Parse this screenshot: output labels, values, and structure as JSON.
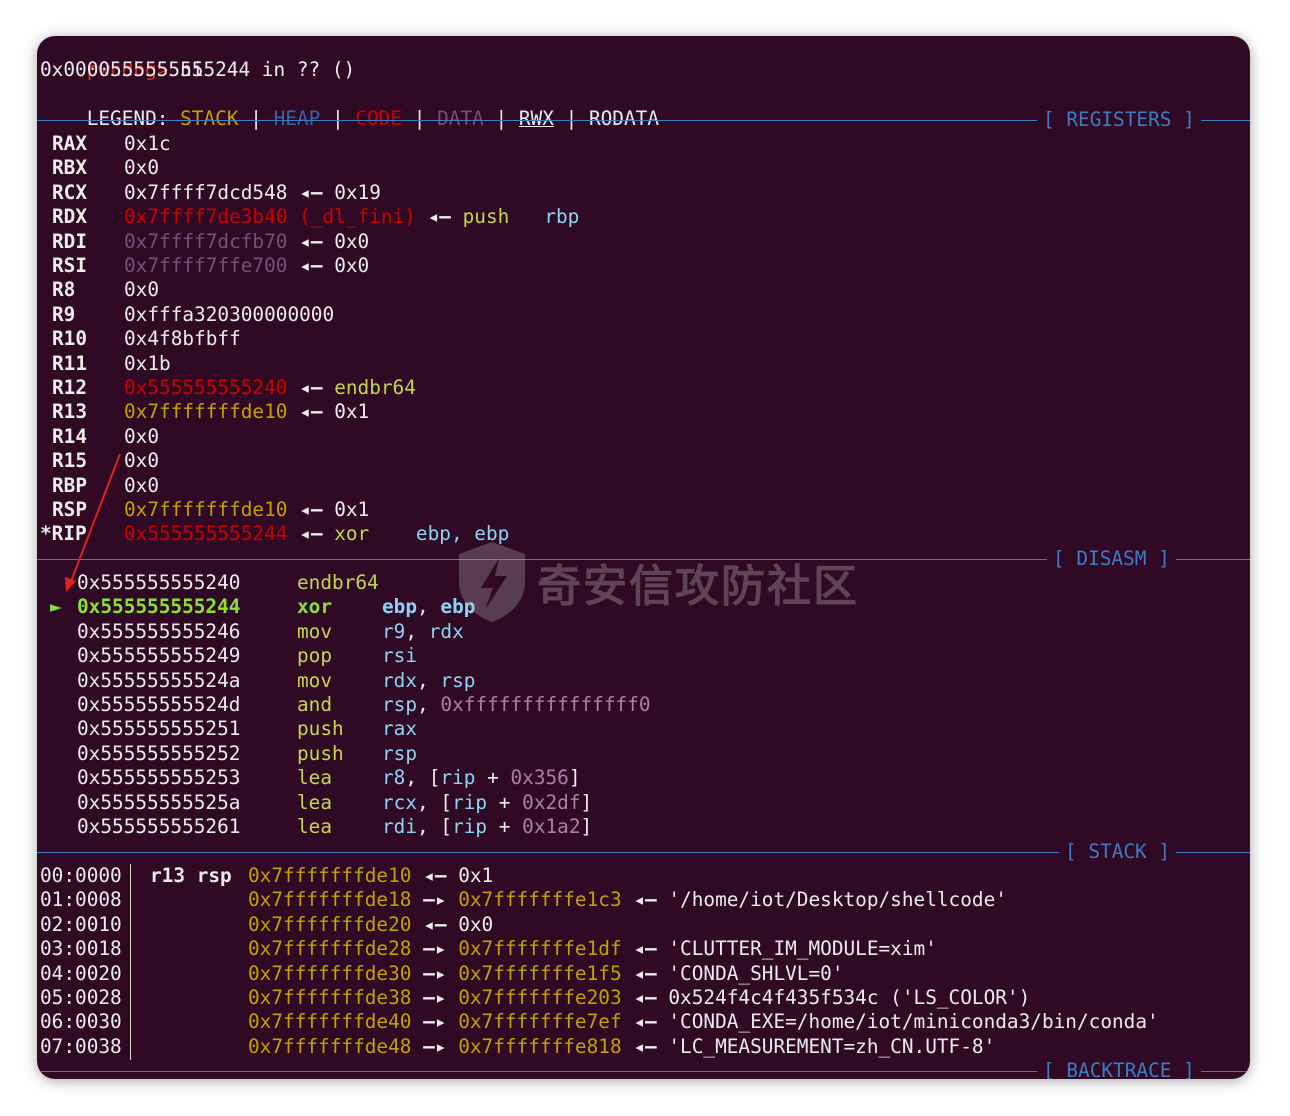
{
  "header": {
    "prompt": "pwndbg>",
    "command": "ni",
    "location": "0x0000555555555244 in ?? ()",
    "legend_label": "LEGEND:",
    "legend": [
      "STACK",
      "HEAP",
      "CODE",
      "DATA",
      "RWX",
      "RODATA"
    ],
    "legend_sep": "|"
  },
  "sections": {
    "registers": "[ REGISTERS ]",
    "disasm": "[ DISASM ]",
    "stack": "[ STACK ]",
    "backtrace": "[ BACKTRACE ]"
  },
  "registers": [
    {
      "name": "RAX",
      "value": "0x1c"
    },
    {
      "name": "RBX",
      "value": "0x0"
    },
    {
      "name": "RCX",
      "value": "0x7ffff7dcd548",
      "arrow": "◂—",
      "target": "0x19"
    },
    {
      "name": "RDX",
      "value": "0x7ffff7de3b40 (_dl_fini)",
      "arrow": "◂—",
      "instr": "push",
      "operands": "rbp"
    },
    {
      "name": "RDI",
      "value": "0x7ffff7dcfb70",
      "arrow": "◂—",
      "target": "0x0"
    },
    {
      "name": "RSI",
      "value": "0x7ffff7ffe700",
      "arrow": "◂—",
      "target": "0x0"
    },
    {
      "name": "R8",
      "value": "0x0"
    },
    {
      "name": "R9",
      "value": "0xfffa320300000000"
    },
    {
      "name": "R10",
      "value": "0x4f8bfbff"
    },
    {
      "name": "R11",
      "value": "0x1b"
    },
    {
      "name": "R12",
      "value": "0x555555555240",
      "arrow": "◂—",
      "instr": "endbr64"
    },
    {
      "name": "R13",
      "value": "0x7fffffffde10",
      "arrow": "◂—",
      "target": "0x1"
    },
    {
      "name": "R14",
      "value": "0x0"
    },
    {
      "name": "R15",
      "value": "0x0"
    },
    {
      "name": "RBP",
      "value": "0x0"
    },
    {
      "name": "RSP",
      "value": "0x7fffffffde10",
      "arrow": "◂—",
      "target": "0x1"
    },
    {
      "name": "*RIP",
      "value": "0x555555555244",
      "arrow": "◂—",
      "instr": "xor",
      "operands": "ebp, ebp"
    }
  ],
  "disasm": [
    {
      "marker": "",
      "addr": "0x555555555240",
      "mnemonic": "endbr64",
      "ops": [],
      "current": false
    },
    {
      "marker": "►",
      "addr": "0x555555555244",
      "mnemonic": "xor",
      "ops": [
        "ebp",
        ", ",
        "ebp"
      ],
      "current": true
    },
    {
      "marker": "",
      "addr": "0x555555555246",
      "mnemonic": "mov",
      "ops": [
        "r9",
        ", ",
        "rdx"
      ],
      "current": false
    },
    {
      "marker": "",
      "addr": "0x555555555249",
      "mnemonic": "pop",
      "ops": [
        "rsi"
      ],
      "current": false
    },
    {
      "marker": "",
      "addr": "0x55555555524a",
      "mnemonic": "mov",
      "ops": [
        "rdx",
        ", ",
        "rsp"
      ],
      "current": false
    },
    {
      "marker": "",
      "addr": "0x55555555524d",
      "mnemonic": "and",
      "ops": [
        "rsp",
        ", ",
        "0xfffffffffffffff0"
      ],
      "current": false
    },
    {
      "marker": "",
      "addr": "0x555555555251",
      "mnemonic": "push",
      "ops": [
        "rax"
      ],
      "current": false
    },
    {
      "marker": "",
      "addr": "0x555555555252",
      "mnemonic": "push",
      "ops": [
        "rsp"
      ],
      "current": false
    },
    {
      "marker": "",
      "addr": "0x555555555253",
      "mnemonic": "lea",
      "ops": [
        "r8",
        ", ",
        "[",
        "rip",
        " + ",
        "0x356",
        "]"
      ],
      "current": false
    },
    {
      "marker": "",
      "addr": "0x55555555525a",
      "mnemonic": "lea",
      "ops": [
        "rcx",
        ", ",
        "[",
        "rip",
        " + ",
        "0x2df",
        "]"
      ],
      "current": false
    },
    {
      "marker": "",
      "addr": "0x555555555261",
      "mnemonic": "lea",
      "ops": [
        "rdi",
        ", ",
        "[",
        "rip",
        " + ",
        "0x1a2",
        "]"
      ],
      "current": false
    }
  ],
  "stack": [
    {
      "index": "00:0000",
      "regs": "r13 rsp",
      "addr": "0x7fffffffde10",
      "arrow1": "◂—",
      "value": "0x1"
    },
    {
      "index": "01:0008",
      "regs": "",
      "addr": "0x7fffffffde18",
      "arrow1": "—▸",
      "ptr": "0x7fffffffe1c3",
      "arrow2": "◂—",
      "value": "'/home/iot/Desktop/shellcode'"
    },
    {
      "index": "02:0010",
      "regs": "",
      "addr": "0x7fffffffde20",
      "arrow1": "◂—",
      "value": "0x0"
    },
    {
      "index": "03:0018",
      "regs": "",
      "addr": "0x7fffffffde28",
      "arrow1": "—▸",
      "ptr": "0x7fffffffe1df",
      "arrow2": "◂—",
      "value": "'CLUTTER_IM_MODULE=xim'"
    },
    {
      "index": "04:0020",
      "regs": "",
      "addr": "0x7fffffffde30",
      "arrow1": "—▸",
      "ptr": "0x7fffffffe1f5",
      "arrow2": "◂—",
      "value": "'CONDA_SHLVL=0'"
    },
    {
      "index": "05:0028",
      "regs": "",
      "addr": "0x7fffffffde38",
      "arrow1": "—▸",
      "ptr": "0x7fffffffe203",
      "arrow2": "◂—",
      "value": "0x524f4c4f435f534c ('LS_COLOR')"
    },
    {
      "index": "06:0030",
      "regs": "",
      "addr": "0x7fffffffde40",
      "arrow1": "—▸",
      "ptr": "0x7fffffffe7ef",
      "arrow2": "◂—",
      "value": "'CONDA_EXE=/home/iot/miniconda3/bin/conda'"
    },
    {
      "index": "07:0038",
      "regs": "",
      "addr": "0x7fffffffde48",
      "arrow1": "—▸",
      "ptr": "0x7fffffffe818",
      "arrow2": "◂—",
      "value": "'LC_MEASUREMENT=zh_CN.UTF-8'"
    }
  ],
  "watermark": "奇安信攻防社区",
  "colors": {
    "background": "#300a24",
    "separator": "#3d7cc4",
    "stack": "#c4a000",
    "code": "#cc0000",
    "data": "#75507b",
    "instruction": "#c4d64e",
    "register": "#8fd3f4",
    "annotation_arrow": "#e02020"
  }
}
